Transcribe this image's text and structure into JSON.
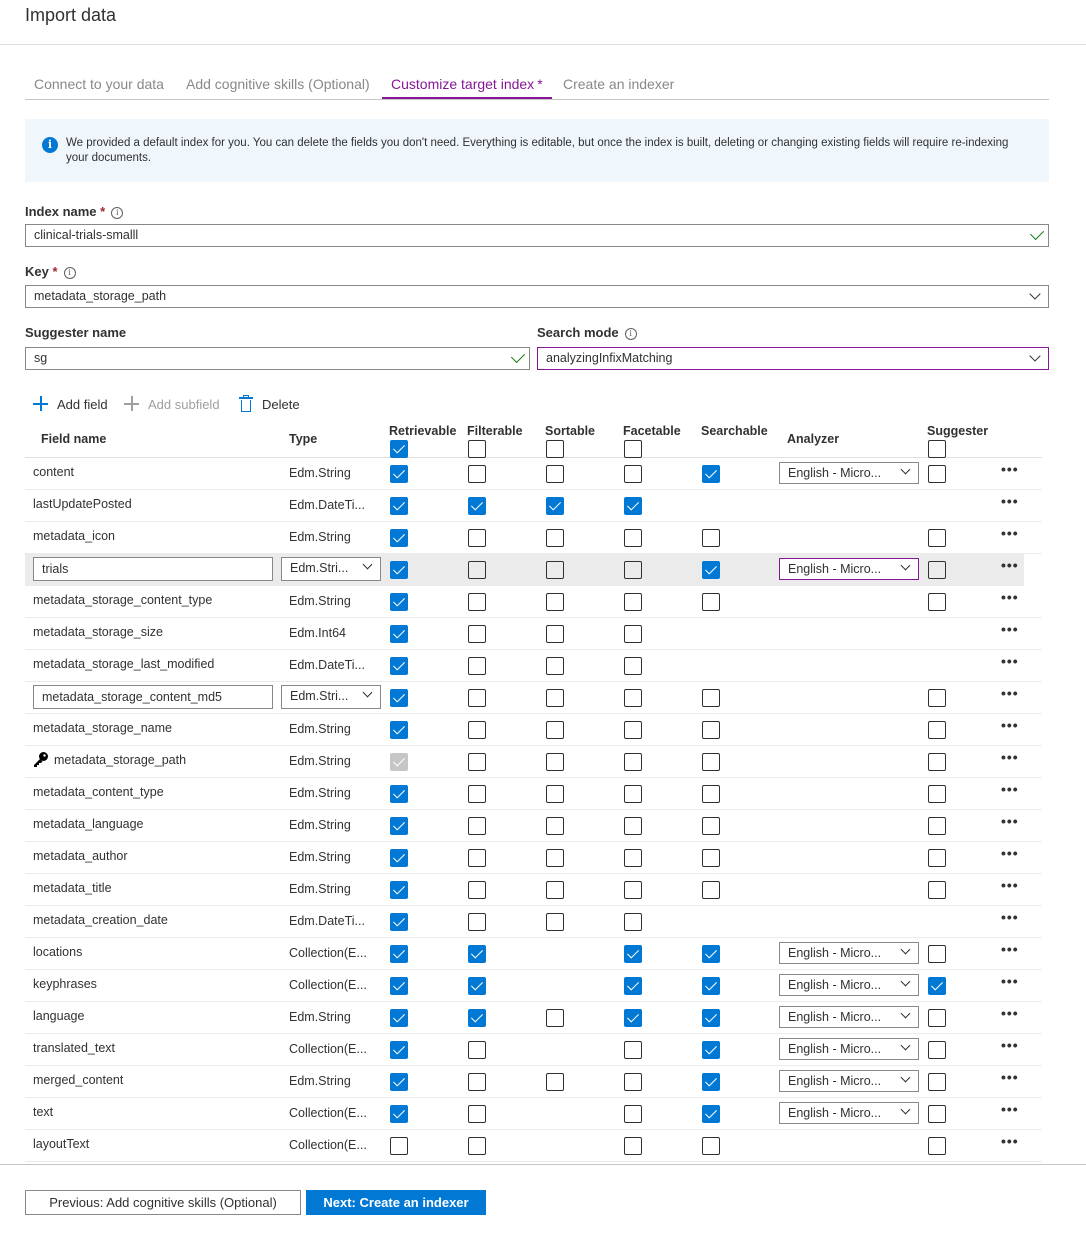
{
  "page": {
    "title": "Import data"
  },
  "tabs": [
    {
      "label": "Connect to your data",
      "active": false
    },
    {
      "label": "Add cognitive skills (Optional)",
      "active": false
    },
    {
      "label": "Customize target index",
      "active": true,
      "required_mark": "*"
    },
    {
      "label": "Create an indexer",
      "active": false
    }
  ],
  "info": {
    "text": "We provided a default index for you. You can delete the fields you don't need. Everything is editable, but once the index is built, deleting or changing existing fields will require re-indexing your documents."
  },
  "form": {
    "index_name": {
      "label": "Index name",
      "required": "*",
      "value": "clinical-trials-smalll"
    },
    "key": {
      "label": "Key",
      "required": "*",
      "value": "metadata_storage_path"
    },
    "suggester_name": {
      "label": "Suggester name",
      "value": "sg"
    },
    "search_mode": {
      "label": "Search mode",
      "value": "analyzingInfixMatching"
    }
  },
  "toolbar": {
    "add_field": "Add field",
    "add_subfield": "Add subfield",
    "delete": "Delete"
  },
  "columns": {
    "field_name": "Field name",
    "type": "Type",
    "retrievable": "Retrievable",
    "filterable": "Filterable",
    "sortable": "Sortable",
    "facetable": "Facetable",
    "searchable": "Searchable",
    "analyzer": "Analyzer",
    "suggester": "Suggester"
  },
  "header_checks": {
    "retrievable": true,
    "filterable": false,
    "sortable": false,
    "facetable": false,
    "searchable": null,
    "suggester": false
  },
  "fields": [
    {
      "name": "content",
      "type": "Edm.String",
      "r": true,
      "f": false,
      "s": false,
      "fa": false,
      "se": true,
      "analyzer": "English - Micro...",
      "sg": false
    },
    {
      "name": "lastUpdatePosted",
      "type": "Edm.DateTi...",
      "r": true,
      "f": true,
      "s": true,
      "fa": true,
      "se": null,
      "analyzer": null,
      "sg": null
    },
    {
      "name": "metadata_icon",
      "type": "Edm.String",
      "r": true,
      "f": false,
      "s": false,
      "fa": false,
      "se": false,
      "analyzer": null,
      "sg": false
    },
    {
      "name": "trials",
      "type": "Edm.Stri...",
      "editing": true,
      "highlight": true,
      "r": true,
      "f": false,
      "s": false,
      "fa": false,
      "se": true,
      "analyzer": "English - Micro...",
      "analyzer_focused": true,
      "sg": false
    },
    {
      "name": "metadata_storage_content_type",
      "type": "Edm.String",
      "r": true,
      "f": false,
      "s": false,
      "fa": false,
      "se": false,
      "analyzer": null,
      "sg": false
    },
    {
      "name": "metadata_storage_size",
      "type": "Edm.Int64",
      "r": true,
      "f": false,
      "s": false,
      "fa": false,
      "se": null,
      "analyzer": null,
      "sg": null
    },
    {
      "name": "metadata_storage_last_modified",
      "type": "Edm.DateTi...",
      "r": true,
      "f": false,
      "s": false,
      "fa": false,
      "se": null,
      "analyzer": null,
      "sg": null
    },
    {
      "name": "metadata_storage_content_md5",
      "type": "Edm.Stri...",
      "editing": true,
      "r": true,
      "f": false,
      "s": false,
      "fa": false,
      "se": false,
      "analyzer": null,
      "sg": false
    },
    {
      "name": "metadata_storage_name",
      "type": "Edm.String",
      "r": true,
      "f": false,
      "s": false,
      "fa": false,
      "se": false,
      "analyzer": null,
      "sg": false
    },
    {
      "name": "metadata_storage_path",
      "type": "Edm.String",
      "key": true,
      "r": "disabled",
      "f": false,
      "s": false,
      "fa": false,
      "se": false,
      "analyzer": null,
      "sg": false
    },
    {
      "name": "metadata_content_type",
      "type": "Edm.String",
      "r": true,
      "f": false,
      "s": false,
      "fa": false,
      "se": false,
      "analyzer": null,
      "sg": false
    },
    {
      "name": "metadata_language",
      "type": "Edm.String",
      "r": true,
      "f": false,
      "s": false,
      "fa": false,
      "se": false,
      "analyzer": null,
      "sg": false
    },
    {
      "name": "metadata_author",
      "type": "Edm.String",
      "r": true,
      "f": false,
      "s": false,
      "fa": false,
      "se": false,
      "analyzer": null,
      "sg": false
    },
    {
      "name": "metadata_title",
      "type": "Edm.String",
      "r": true,
      "f": false,
      "s": false,
      "fa": false,
      "se": false,
      "analyzer": null,
      "sg": false
    },
    {
      "name": "metadata_creation_date",
      "type": "Edm.DateTi...",
      "r": true,
      "f": false,
      "s": false,
      "fa": false,
      "se": null,
      "analyzer": null,
      "sg": null
    },
    {
      "name": "locations",
      "type": "Collection(E...",
      "r": true,
      "f": true,
      "s": null,
      "fa": true,
      "se": true,
      "analyzer": "English - Micro...",
      "sg": false
    },
    {
      "name": "keyphrases",
      "type": "Collection(E...",
      "r": true,
      "f": true,
      "s": null,
      "fa": true,
      "se": true,
      "analyzer": "English - Micro...",
      "sg": true
    },
    {
      "name": "language",
      "type": "Edm.String",
      "r": true,
      "f": true,
      "s": false,
      "fa": true,
      "se": true,
      "analyzer": "English - Micro...",
      "sg": false
    },
    {
      "name": "translated_text",
      "type": "Collection(E...",
      "r": true,
      "f": false,
      "s": null,
      "fa": false,
      "se": true,
      "analyzer": "English - Micro...",
      "sg": false
    },
    {
      "name": "merged_content",
      "type": "Edm.String",
      "r": true,
      "f": false,
      "s": false,
      "fa": false,
      "se": true,
      "analyzer": "English - Micro...",
      "sg": false
    },
    {
      "name": "text",
      "type": "Collection(E...",
      "r": true,
      "f": false,
      "s": null,
      "fa": false,
      "se": true,
      "analyzer": "English - Micro...",
      "sg": false
    },
    {
      "name": "layoutText",
      "type": "Collection(E...",
      "r": false,
      "f": false,
      "s": null,
      "fa": false,
      "se": false,
      "analyzer": null,
      "sg": false
    }
  ],
  "row_menu": "•••",
  "buttons": {
    "previous": "Previous: Add cognitive skills (Optional)",
    "next": "Next: Create an indexer"
  },
  "colors": {
    "accent": "#0078d4",
    "tab_active": "#881798",
    "info_bg": "#eff6fc",
    "valid": "#107c10",
    "required": "#a4262c"
  }
}
